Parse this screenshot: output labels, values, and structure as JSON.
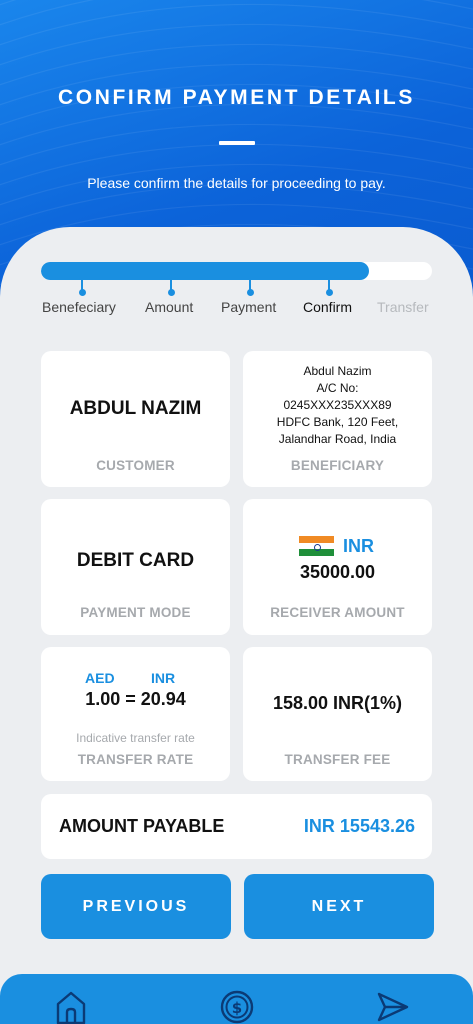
{
  "header": {
    "title": "CONFIRM PAYMENT DETAILS",
    "subtitle": "Please confirm the details for proceeding to pay."
  },
  "progress": {
    "value": 0.84,
    "steps": [
      {
        "label": "Benefeciary",
        "state": "done"
      },
      {
        "label": "Amount",
        "state": "done"
      },
      {
        "label": "Payment",
        "state": "done"
      },
      {
        "label": "Confirm",
        "state": "active"
      },
      {
        "label": "Transfer",
        "state": "pending"
      }
    ]
  },
  "cards": {
    "customer": {
      "value": "ABDUL NAZIM",
      "caption": "CUSTOMER"
    },
    "beneficiary": {
      "lines": [
        "Abdul Nazim",
        "A/C No:",
        "0245XXX235XXX89",
        "HDFC Bank, 120 Feet,",
        "Jalandhar Road, India"
      ],
      "caption": "BENEFICIARY"
    },
    "payment_mode": {
      "value": "DEBIT CARD",
      "caption": "PAYMENT MODE"
    },
    "receiver_amount": {
      "currency": "INR",
      "amount": "35000.00",
      "caption": "RECEIVER AMOUNT",
      "flag": "india-flag-icon"
    },
    "transfer_rate": {
      "from": "AED",
      "to": "INR",
      "rate": "1.00 = 20.94",
      "note": "Indicative transfer rate",
      "caption": "TRANSFER RATE"
    },
    "transfer_fee": {
      "value": "158.00 INR(1%)",
      "caption": "TRANSFER FEE"
    }
  },
  "payable": {
    "label": "AMOUNT PAYABLE",
    "value": "INR 15543.26"
  },
  "buttons": {
    "previous": "PREVIOUS",
    "next": "NEXT"
  },
  "bottom_nav": {
    "items": [
      "home-icon",
      "dollar-coin-icon",
      "send-icon"
    ]
  },
  "colors": {
    "accent": "#1a8fe0",
    "header": "#0c63d9",
    "background": "#eceef1",
    "caption": "#a6a9ad"
  }
}
